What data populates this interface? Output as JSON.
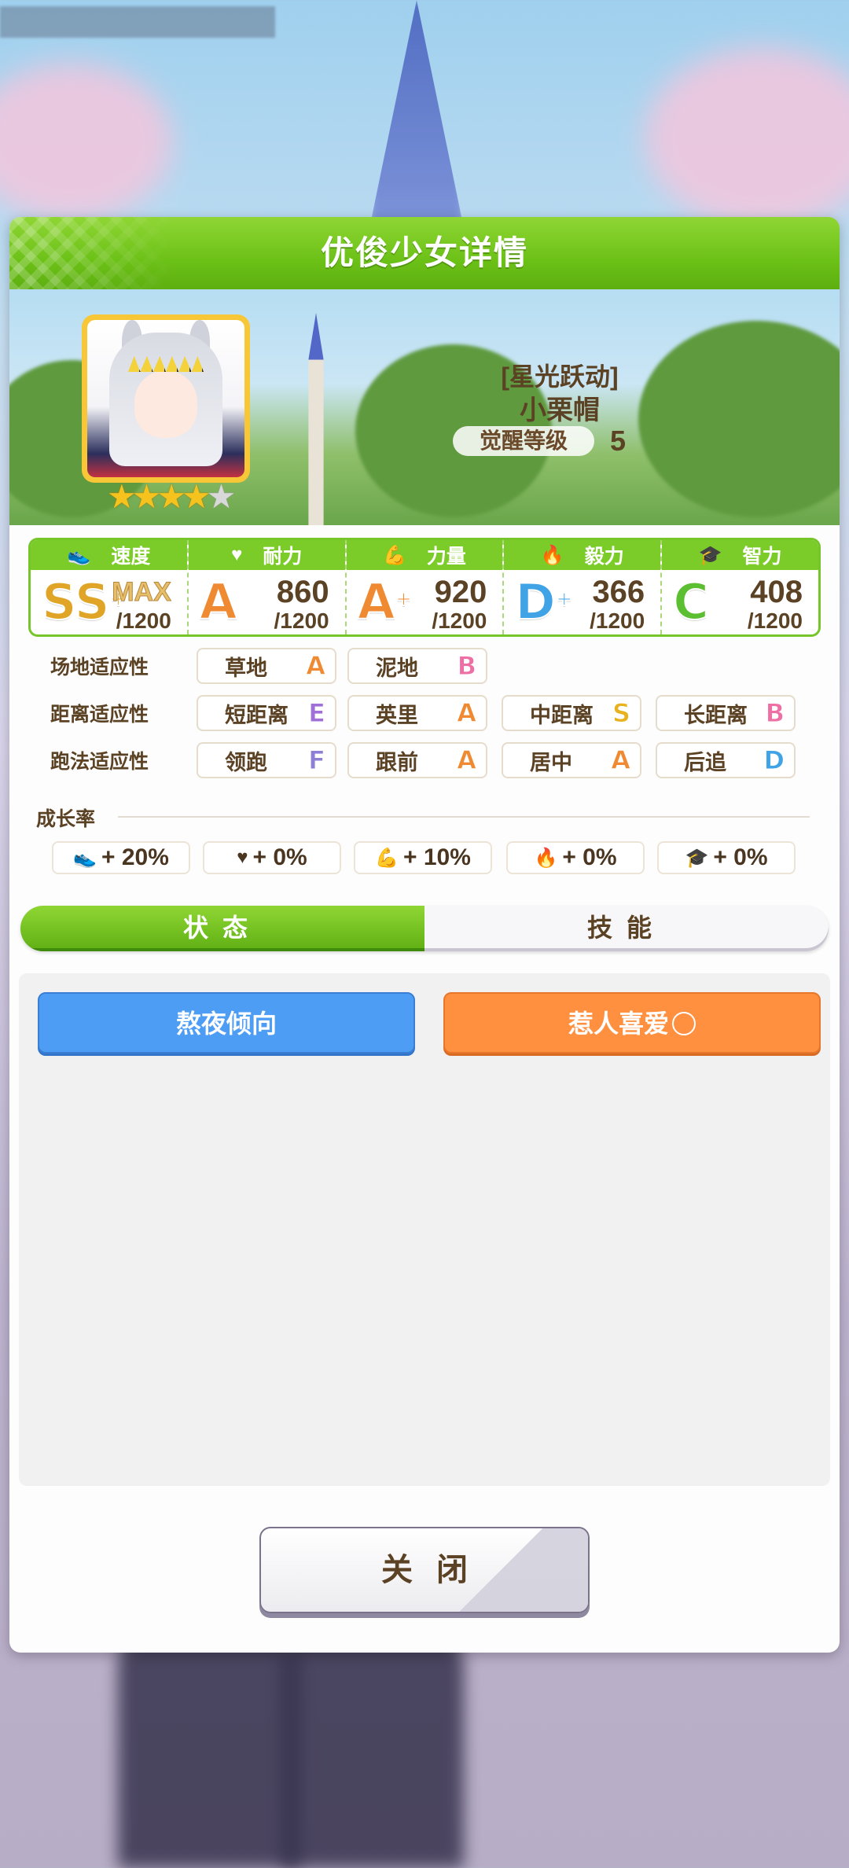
{
  "background": {
    "top_label": ""
  },
  "panel": {
    "title": "优俊少女详情"
  },
  "card": {
    "title": "[星光跃动]",
    "name": "小栗帽",
    "awaken_label": "觉醒等级",
    "awaken_value": "5",
    "stars_filled": 4,
    "stars_total": 5
  },
  "stats": [
    {
      "name": "速度",
      "icon": "shoe-icon",
      "glyph": "👟",
      "grade": "SS",
      "plus": "+",
      "grade_color": "#e0a526",
      "value": "MAX",
      "max": "/1200"
    },
    {
      "name": "耐力",
      "icon": "heart-icon",
      "glyph": "♥",
      "grade": "A",
      "plus": "",
      "grade_color": "#f08a32",
      "value": "860",
      "max": "/1200"
    },
    {
      "name": "力量",
      "icon": "muscle-icon",
      "glyph": "💪",
      "grade": "A",
      "plus": "+",
      "grade_color": "#f08a32",
      "value": "920",
      "max": "/1200"
    },
    {
      "name": "毅力",
      "icon": "flame-icon",
      "glyph": "🔥",
      "grade": "D",
      "plus": "+",
      "grade_color": "#3fa3e6",
      "value": "366",
      "max": "/1200"
    },
    {
      "name": "智力",
      "icon": "graduation-cap-icon",
      "glyph": "🎓",
      "grade": "C",
      "plus": "",
      "grade_color": "#5cbf32",
      "value": "408",
      "max": "/1200"
    }
  ],
  "aptitude": {
    "surface": {
      "label": "场地适应性",
      "items": [
        {
          "name": "草地",
          "grade": "A"
        },
        {
          "name": "泥地",
          "grade": "B"
        }
      ]
    },
    "distance": {
      "label": "距离适应性",
      "items": [
        {
          "name": "短距离",
          "grade": "E"
        },
        {
          "name": "英里",
          "grade": "A"
        },
        {
          "name": "中距离",
          "grade": "S"
        },
        {
          "name": "长距离",
          "grade": "B"
        }
      ]
    },
    "strategy": {
      "label": "跑法适应性",
      "items": [
        {
          "name": "领跑",
          "grade": "F"
        },
        {
          "name": "跟前",
          "grade": "A"
        },
        {
          "name": "居中",
          "grade": "A"
        },
        {
          "name": "后追",
          "grade": "D"
        }
      ]
    }
  },
  "grade_colors": {
    "S": "#e8b21e",
    "A": "#f08a32",
    "B": "#ee6fa3",
    "C": "#5cbf32",
    "D": "#3fa3e6",
    "E": "#a070d8",
    "F": "#8e7fd6"
  },
  "growth": {
    "title": "成长率",
    "items": [
      {
        "icon": "shoe-icon",
        "glyph": "👟",
        "value": "+ 20%"
      },
      {
        "icon": "heart-icon",
        "glyph": "♥",
        "value": "+ 0%"
      },
      {
        "icon": "muscle-icon",
        "glyph": "💪",
        "value": "+ 10%"
      },
      {
        "icon": "flame-icon",
        "glyph": "🔥",
        "value": "+ 0%"
      },
      {
        "icon": "graduation-cap-icon",
        "glyph": "🎓",
        "value": "+ 0%"
      }
    ]
  },
  "tabs": {
    "status": "状态",
    "skills": "技能"
  },
  "status_effects": [
    {
      "label": "熬夜倾向",
      "color": "blue"
    },
    {
      "label": "惹人喜爱",
      "color": "orange",
      "mark": "circle"
    }
  ],
  "close_label": "关闭"
}
